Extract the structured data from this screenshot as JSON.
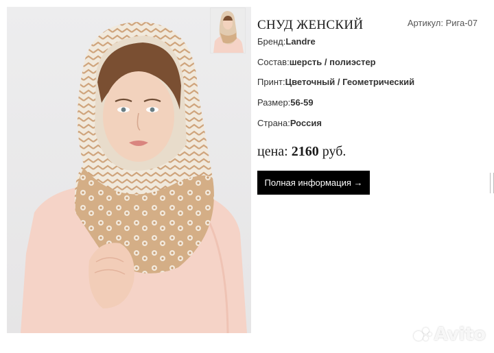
{
  "product": {
    "title": "СНУД ЖЕНСКИЙ",
    "sku": "Артикул: Рига-07",
    "properties": [
      {
        "label": "Бренд:",
        "value": "Landre"
      },
      {
        "label": "Состав:",
        "value": "шерсть / полиэстер"
      },
      {
        "label": "Принт:",
        "value": "Цветочный / Геометрический"
      },
      {
        "label": "Размер:",
        "value": "56-59"
      },
      {
        "label": "Страна:",
        "value": "Россия"
      }
    ],
    "price_label": "цена:",
    "price_value": "2160",
    "price_currency": "руб.",
    "more_button": "Полная информация →"
  },
  "watermark": "Avito",
  "colors": {
    "button_bg": "#000000",
    "button_text": "#ffffff",
    "scarf_beige": "#d9b48e",
    "scarf_cream": "#f3ece1",
    "blouse_pink": "#f6d2c6"
  }
}
